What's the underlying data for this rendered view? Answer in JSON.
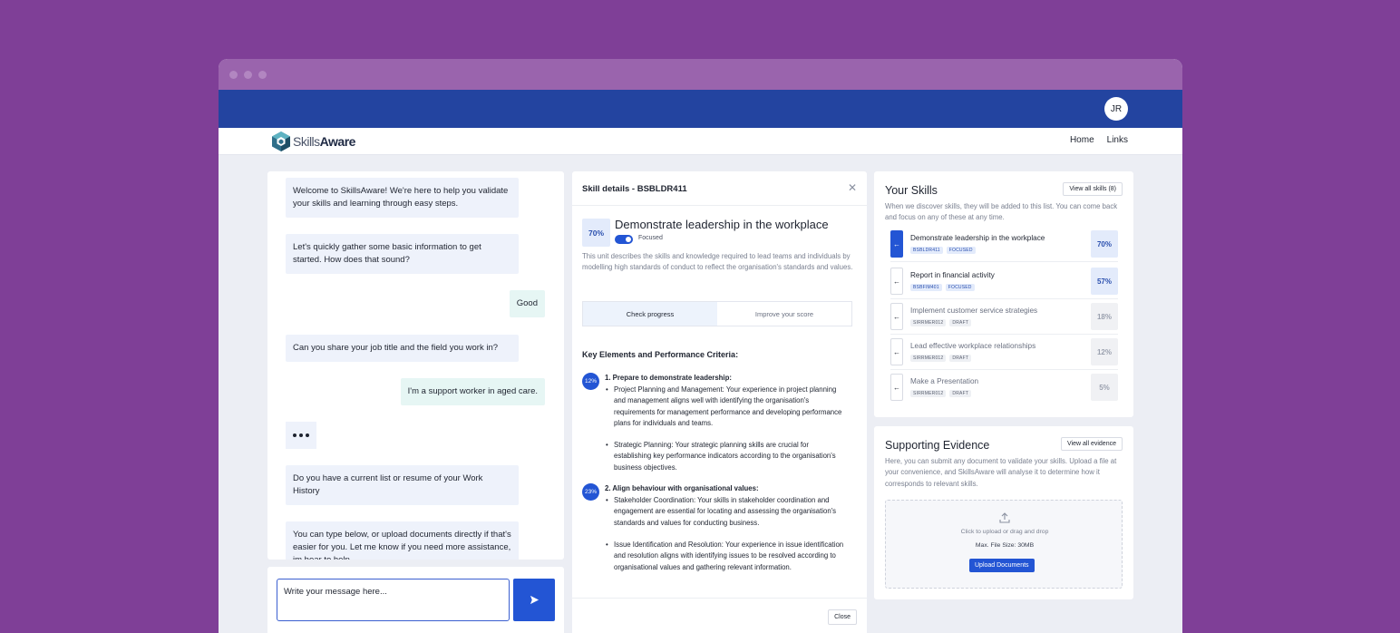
{
  "header": {
    "avatar_initials": "JR"
  },
  "nav": {
    "logo_prefix": "Skills",
    "logo_suffix": "Aware",
    "home": "Home",
    "links": "Links"
  },
  "chat": {
    "messages": [
      {
        "from": "bot",
        "text": "Welcome to SkillsAware! We're here to help you validate your skills and learning through easy steps."
      },
      {
        "from": "bot",
        "text": "Let's quickly gather some basic information to get started. How does that sound?"
      },
      {
        "from": "user",
        "text": "Good"
      },
      {
        "from": "bot",
        "text": "Can you share your job title and the field you work in?"
      },
      {
        "from": "user",
        "text": "I'm a support worker in aged care."
      },
      {
        "from": "bot",
        "text": "Do you have a current list or resume of your Work History"
      },
      {
        "from": "bot",
        "text": "You can type below, or upload documents directly if that's easier for you. Let me know if you need more assistance, im hear to help"
      }
    ],
    "input_placeholder": "Write your message here..."
  },
  "skill_details": {
    "title": "Skill details - BSBLDR411",
    "percent": "70%",
    "name": "Demonstrate leadership in the workplace",
    "toggle_label": "Focused",
    "description": "This unit describes the skills and knowledge required to lead teams and individuals by modelling high standards of conduct to reflect the organisation's standards and values.",
    "tabs": [
      "Check progress",
      "Improve your score"
    ],
    "criteria_title": "Key Elements and Performance Criteria:",
    "criteria": [
      {
        "percent": "12%",
        "title": "1. Prepare to demonstrate leadership:",
        "items": [
          "Project Planning and Management: Your experience in project planning and management aligns well with identifying the organisation's requirements for management performance and developing performance plans for individuals and teams.",
          "Strategic Planning: Your strategic planning skills are crucial for establishing key performance indicators according to the organisation's business objectives."
        ]
      },
      {
        "percent": "23%",
        "title": "2. Align behaviour with organisational values:",
        "items": [
          "Stakeholder Coordination: Your skills in stakeholder coordination and engagement are essential for locating and assessing the organisation's standards and values for conducting business.",
          "Issue Identification and Resolution: Your experience in issue identification and resolution aligns with identifying issues to be resolved according to organisational values and gathering relevant information."
        ]
      }
    ],
    "close_label": "Close"
  },
  "your_skills": {
    "title": "Your Skills",
    "view_all": "View all skills (8)",
    "description": "When we discover skills, they will be added to this list. You can come back and focus on any of these at any time.",
    "items": [
      {
        "name": "Demonstrate leadership in the workplace",
        "code": "BSBLDR411",
        "status": "FOCUSED",
        "percent": "70%"
      },
      {
        "name": "Report in financial activity",
        "code": "BSBFIM401",
        "status": "FOCUSED",
        "percent": "57%"
      },
      {
        "name": "Implement customer service strategies",
        "code": "SIRRMER012",
        "status": "DRAFT",
        "percent": "18%"
      },
      {
        "name": "Lead effective workplace relationships",
        "code": "SIRRMER012",
        "status": "DRAFT",
        "percent": "12%"
      },
      {
        "name": "Make a Presentation",
        "code": "SIRRMER012",
        "status": "DRAFT",
        "percent": "5%"
      }
    ]
  },
  "evidence": {
    "title": "Supporting Evidence",
    "view_all": "View all evidence",
    "description": "Here, you can submit any document to validate your skills. Upload a file at your convenience, and SkillsAware will analyse it to determine how it corresponds to relevant skills.",
    "drop_text": "Click to upload or drag and drop",
    "max_size": "Max. File Size: 30MB",
    "upload_label": "Upload Documents"
  },
  "colors": {
    "accent": "#2355d4",
    "header": "#2344a0",
    "background": "#7f3f97"
  }
}
